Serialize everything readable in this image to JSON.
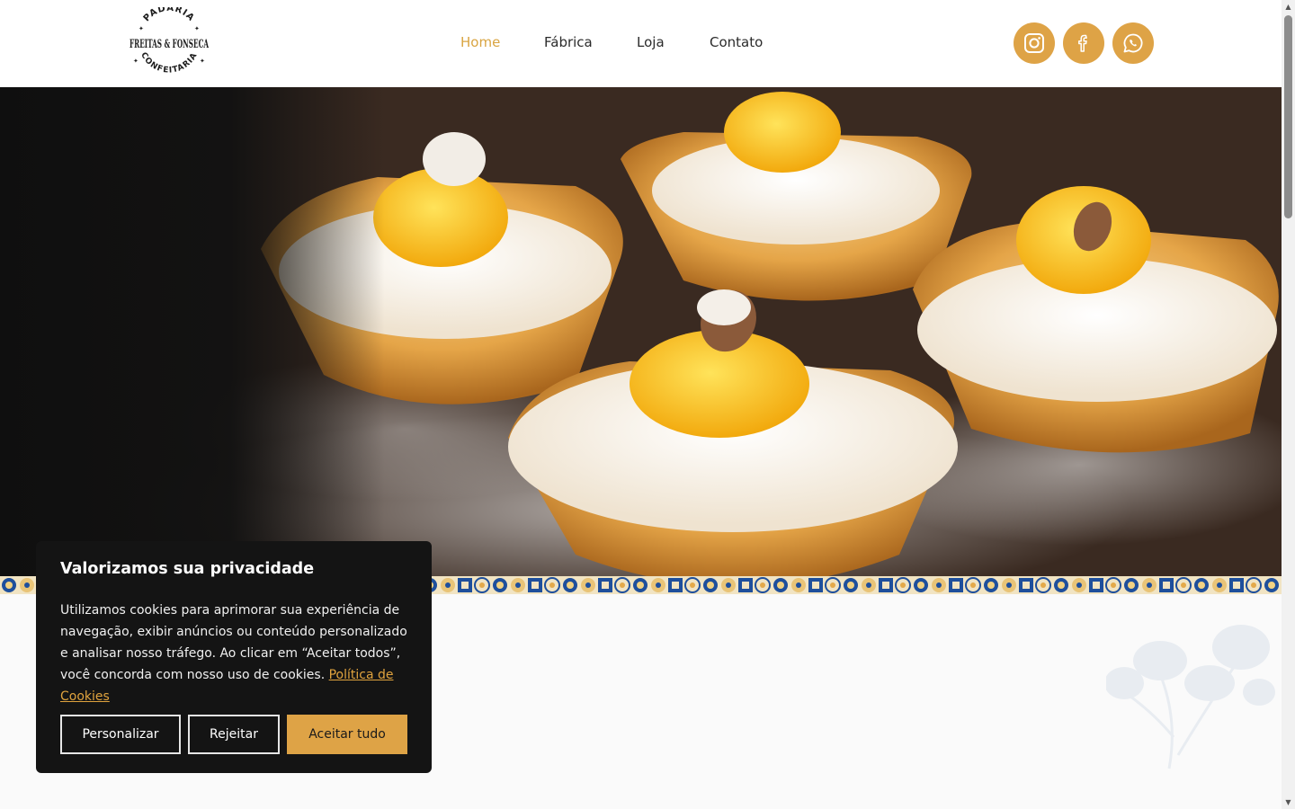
{
  "brand": {
    "logo_top": "PADARIA",
    "logo_middle": "FREITAS & FONSECA",
    "logo_bottom": "CONFEITARIA"
  },
  "nav": {
    "items": [
      {
        "label": "Home",
        "active": true
      },
      {
        "label": "Fábrica",
        "active": false
      },
      {
        "label": "Loja",
        "active": false
      },
      {
        "label": "Contato",
        "active": false
      }
    ]
  },
  "social": {
    "icons": [
      "instagram-icon",
      "facebook-icon",
      "whatsapp-icon"
    ],
    "color": "#dea346"
  },
  "hero": {
    "image_subject": "pastry-tartlets"
  },
  "cookie_banner": {
    "title": "Valorizamos sua privacidade",
    "body": "Utilizamos cookies para aprimorar sua experiência de navegação, exibir anúncios ou conteúdo personalizado e analisar nosso tráfego. Ao clicar em “Aceitar todos”, você concorda com nosso uso de cookies.",
    "policy_link": "Política de Cookies",
    "buttons": {
      "customize": "Personalizar",
      "reject": "Rejeitar",
      "accept": "Aceitar tudo"
    }
  },
  "colors": {
    "accent": "#dea346",
    "nav_active": "#d9a441",
    "banner_bg": "#141414",
    "tile_blue": "#1e4f9c"
  }
}
